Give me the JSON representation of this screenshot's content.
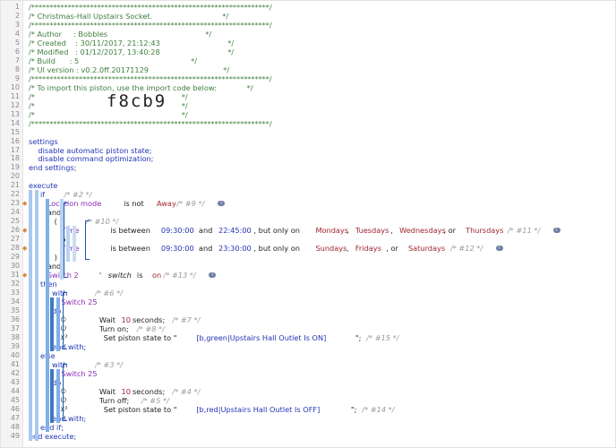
{
  "lines": [
    {
      "n": "1",
      "parts": [
        {
          "t": "/*****************************************************************/",
          "c": "cm"
        }
      ]
    },
    {
      "n": "2",
      "parts": [
        {
          "t": "/* Christmas-Hall Upstairs Socket.                              */",
          "c": "cm"
        }
      ]
    },
    {
      "n": "3",
      "parts": [
        {
          "t": "/*****************************************************************/",
          "c": "cm"
        }
      ]
    },
    {
      "n": "4",
      "parts": [
        {
          "t": "/* Author     : Bobbles                                          */",
          "c": "cm"
        }
      ]
    },
    {
      "n": "5",
      "parts": [
        {
          "t": "/* Created    : 30/11/2017, 21:12:43                             */",
          "c": "cm"
        }
      ]
    },
    {
      "n": "6",
      "parts": [
        {
          "t": "/* Modified   : 01/12/2017, 13:40:28                             */",
          "c": "cm"
        }
      ]
    },
    {
      "n": "7",
      "parts": [
        {
          "t": "/* Build      : 5                                                */",
          "c": "cm"
        }
      ]
    },
    {
      "n": "8",
      "parts": [
        {
          "t": "/* UI version : v0.2.0ff.20171129                                */",
          "c": "cm"
        }
      ]
    },
    {
      "n": "9",
      "parts": [
        {
          "t": "/*****************************************************************/",
          "c": "cm"
        }
      ]
    },
    {
      "n": "10",
      "parts": [
        {
          "t": "/* To import this piston, use the import code below:             */",
          "c": "cm"
        }
      ]
    },
    {
      "n": "11",
      "parts": [
        {
          "t": "/*                                                               */",
          "c": "cm"
        }
      ]
    },
    {
      "n": "12",
      "parts": [
        {
          "t": "/*                                                               */",
          "c": "cm"
        }
      ]
    },
    {
      "n": "13",
      "parts": [
        {
          "t": "/*                                                               */",
          "c": "cm"
        }
      ]
    },
    {
      "n": "14",
      "parts": [
        {
          "t": "/*****************************************************************/",
          "c": "cm"
        }
      ]
    },
    {
      "n": "15",
      "parts": []
    },
    {
      "n": "16",
      "parts": [
        {
          "t": "settings",
          "c": "kw"
        }
      ]
    },
    {
      "n": "17",
      "parts": [
        {
          "t": "    disable automatic piston state;",
          "c": "kw"
        }
      ]
    },
    {
      "n": "18",
      "parts": [
        {
          "t": "    disable command optimization;",
          "c": "kw"
        }
      ]
    },
    {
      "n": "19",
      "parts": [
        {
          "t": "end settings;",
          "c": "kw"
        }
      ]
    },
    {
      "n": "20",
      "parts": []
    },
    {
      "n": "21",
      "parts": [
        {
          "t": "execute",
          "c": "kw"
        }
      ]
    },
    {
      "n": "22",
      "parts": [
        {
          "t": "     if ",
          "c": "kw"
        },
        {
          "t": "/* #2 */",
          "c": "gr"
        }
      ]
    },
    {
      "n": "23",
      "mark": true,
      "parts": [
        {
          "t": "        Location mode",
          "c": "pu"
        },
        {
          "t": " is not ",
          "c": "bk"
        },
        {
          "t": "Away",
          "c": "rd"
        },
        {
          "t": " /* #9 */",
          "c": "gr"
        },
        {
          "t": "i",
          "c": "info"
        }
      ]
    },
    {
      "n": "24",
      "parts": [
        {
          "t": "        and",
          "c": "bk"
        }
      ]
    },
    {
      "n": "25",
      "parts": [
        {
          "t": "           ( ",
          "c": "bk"
        },
        {
          "t": "/* #10 */",
          "c": "gr"
        }
      ]
    },
    {
      "n": "26",
      "mark": true,
      "parts": [
        {
          "t": "              Time",
          "c": "pu"
        },
        {
          "t": " is between ",
          "c": "bk"
        },
        {
          "t": "09:30:00",
          "c": "bl"
        },
        {
          "t": " and ",
          "c": "bk"
        },
        {
          "t": "22:45:00",
          "c": "bl"
        },
        {
          "t": ", but only on ",
          "c": "bk"
        },
        {
          "t": "Mondays",
          "c": "rd"
        },
        {
          "t": ", ",
          "c": "bk"
        },
        {
          "t": "Tuesdays",
          "c": "rd"
        },
        {
          "t": ", ",
          "c": "bk"
        },
        {
          "t": "Wednesdays",
          "c": "rd"
        },
        {
          "t": ", or ",
          "c": "bk"
        },
        {
          "t": "Thursdays",
          "c": "rd"
        },
        {
          "t": " /* #11 */",
          "c": "gr"
        },
        {
          "t": "i",
          "c": "info"
        }
      ]
    },
    {
      "n": "27",
      "parts": [
        {
          "t": "              or",
          "c": "bk"
        }
      ]
    },
    {
      "n": "28",
      "mark": true,
      "parts": [
        {
          "t": "              Time",
          "c": "pu"
        },
        {
          "t": " is between ",
          "c": "bk"
        },
        {
          "t": "09:30:00",
          "c": "bl"
        },
        {
          "t": " and ",
          "c": "bk"
        },
        {
          "t": "23:30:00",
          "c": "bl"
        },
        {
          "t": ", but only on ",
          "c": "bk"
        },
        {
          "t": "Sundays",
          "c": "rd"
        },
        {
          "t": ", ",
          "c": "bk"
        },
        {
          "t": "Fridays",
          "c": "rd"
        },
        {
          "t": ", or ",
          "c": "bk"
        },
        {
          "t": "Saturdays",
          "c": "rd"
        },
        {
          "t": " /* #12 */",
          "c": "gr"
        },
        {
          "t": "i",
          "c": "info"
        }
      ]
    },
    {
      "n": "29",
      "parts": [
        {
          "t": "           )",
          "c": "bk"
        }
      ]
    },
    {
      "n": "30",
      "parts": [
        {
          "t": "        and",
          "c": "bk"
        }
      ]
    },
    {
      "n": "31",
      "mark": true,
      "parts": [
        {
          "t": "        Switch 2",
          "c": "pu"
        },
        {
          "t": "' ",
          "c": "bk"
        },
        {
          "t": "switch",
          "c": "it"
        },
        {
          "t": " is ",
          "c": "bk"
        },
        {
          "t": "on",
          "c": "rd"
        },
        {
          "t": " /* #13 */",
          "c": "gr"
        },
        {
          "t": "i",
          "c": "info"
        }
      ]
    },
    {
      "n": "32",
      "parts": [
        {
          "t": "     then",
          "c": "kw"
        }
      ]
    },
    {
      "n": "33",
      "parts": [
        {
          "t": "          with ",
          "c": "kw"
        },
        {
          "t": "/* #6 */",
          "c": "gr"
        }
      ]
    },
    {
      "n": "34",
      "parts": [
        {
          "t": "              Switch 25",
          "c": "pu"
        }
      ]
    },
    {
      "n": "35",
      "parts": [
        {
          "t": "          do",
          "c": "kw"
        }
      ]
    },
    {
      "n": "36",
      "parts": [
        {
          "t": "              ⏲ ",
          "c": "ico"
        },
        {
          "t": "Wait ",
          "c": "bk"
        },
        {
          "t": "10",
          "c": "rd"
        },
        {
          "t": " seconds;",
          "c": "bk"
        },
        {
          "t": " /* #7 */",
          "c": "gr"
        }
      ]
    },
    {
      "n": "37",
      "parts": [
        {
          "t": "              ⏻ ",
          "c": "ico"
        },
        {
          "t": "Turn on;",
          "c": "bk"
        },
        {
          "t": " /* #8 */",
          "c": "gr"
        }
      ]
    },
    {
      "n": "38",
      "parts": [
        {
          "t": "              x² ",
          "c": "ico"
        },
        {
          "t": "Set piston state to \"",
          "c": "bk"
        },
        {
          "t": "[b,green|Upstairs Hall Outlet Is ON]",
          "c": "bl"
        },
        {
          "t": "\";",
          "c": "bk"
        },
        {
          "t": " /* #15 */",
          "c": "gr"
        }
      ]
    },
    {
      "n": "39",
      "parts": [
        {
          "t": "          end with;",
          "c": "kw"
        }
      ]
    },
    {
      "n": "40",
      "parts": [
        {
          "t": "     else",
          "c": "kw"
        }
      ]
    },
    {
      "n": "41",
      "parts": [
        {
          "t": "          with ",
          "c": "kw"
        },
        {
          "t": "/* #3 */",
          "c": "gr"
        }
      ]
    },
    {
      "n": "42",
      "parts": [
        {
          "t": "              Switch 25",
          "c": "pu"
        }
      ]
    },
    {
      "n": "43",
      "parts": [
        {
          "t": "          do",
          "c": "kw"
        }
      ]
    },
    {
      "n": "44",
      "parts": [
        {
          "t": "              ⏲ ",
          "c": "ico"
        },
        {
          "t": "Wait ",
          "c": "bk"
        },
        {
          "t": "10",
          "c": "rd"
        },
        {
          "t": " seconds;",
          "c": "bk"
        },
        {
          "t": " /* #4 */",
          "c": "gr"
        }
      ]
    },
    {
      "n": "45",
      "parts": [
        {
          "t": "              ⏻ ",
          "c": "ico"
        },
        {
          "t": "Turn off;",
          "c": "bk"
        },
        {
          "t": " /* #5 */",
          "c": "gr"
        }
      ]
    },
    {
      "n": "46",
      "parts": [
        {
          "t": "              x² ",
          "c": "ico"
        },
        {
          "t": "Set piston state to \"",
          "c": "bk"
        },
        {
          "t": "[b,red|Upstairs Hall Outlet Is OFF]",
          "c": "bl"
        },
        {
          "t": "\";",
          "c": "bk"
        },
        {
          "t": " /* #14 */",
          "c": "gr"
        }
      ]
    },
    {
      "n": "47",
      "parts": [
        {
          "t": "          end with;",
          "c": "kw"
        }
      ]
    },
    {
      "n": "48",
      "parts": [
        {
          "t": "     end if;",
          "c": "kw"
        }
      ]
    },
    {
      "n": "49",
      "parts": [
        {
          "t": "end execute;",
          "c": "kw"
        }
      ]
    }
  ],
  "import_code": "f8cb9",
  "colors": {
    "comment": "#3f7f3f",
    "keyword": "#2236b5",
    "device": "#8a2ab8",
    "value": "#a0272e",
    "note": "#9a9a9a",
    "block_bar": "#7fb0e6",
    "block_bar_dark": "#3d78c8",
    "marker": "#d9893a"
  }
}
